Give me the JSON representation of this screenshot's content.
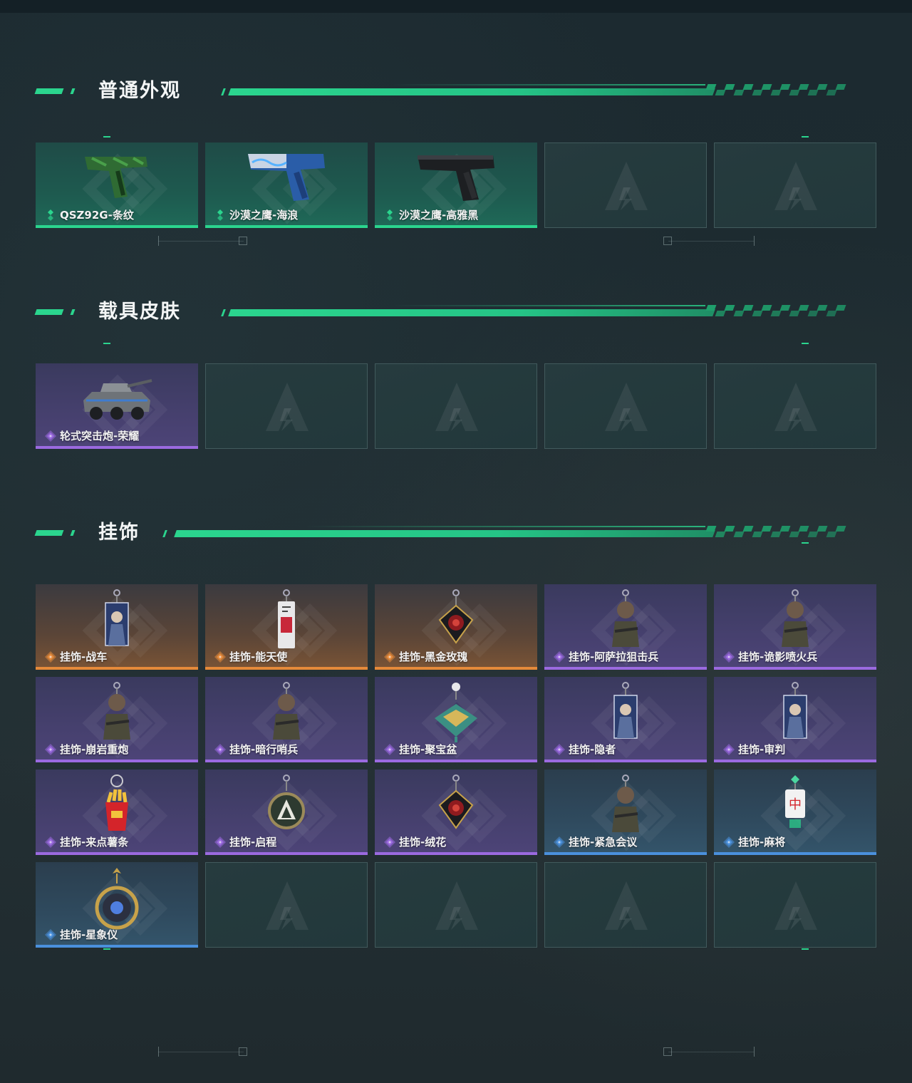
{
  "sections": [
    {
      "title": "普通外观",
      "items": [
        {
          "label": "QSZ92G-条纹",
          "rarity": "green",
          "icon": "pistol-camo-icon"
        },
        {
          "label": "沙漠之鹰-海浪",
          "rarity": "green",
          "icon": "pistol-wave-icon"
        },
        {
          "label": "沙漠之鹰-高雅黑",
          "rarity": "green",
          "icon": "pistol-black-icon"
        },
        {
          "label": "",
          "rarity": "empty"
        },
        {
          "label": "",
          "rarity": "empty"
        }
      ]
    },
    {
      "title": "载具皮肤",
      "items": [
        {
          "label": "轮式突击炮-荣耀",
          "rarity": "purple",
          "icon": "armored-vehicle-icon"
        },
        {
          "label": "",
          "rarity": "empty"
        },
        {
          "label": "",
          "rarity": "empty"
        },
        {
          "label": "",
          "rarity": "empty"
        },
        {
          "label": "",
          "rarity": "empty"
        }
      ]
    },
    {
      "title": "挂饰",
      "items": [
        {
          "label": "挂饰-战车",
          "rarity": "orange",
          "icon": "charm-card-icon"
        },
        {
          "label": "挂饰-能天使",
          "rarity": "orange",
          "icon": "charm-tag-icon"
        },
        {
          "label": "挂饰-黑金玫瑰",
          "rarity": "orange",
          "icon": "charm-rose-icon"
        },
        {
          "label": "挂饰-阿萨拉狙击兵",
          "rarity": "purple",
          "icon": "charm-figure-icon"
        },
        {
          "label": "挂饰-诡影喷火兵",
          "rarity": "purple",
          "icon": "charm-figure-icon"
        },
        {
          "label": "挂饰-崩岩重炮",
          "rarity": "purple",
          "icon": "charm-figure-icon"
        },
        {
          "label": "挂饰-暗行哨兵",
          "rarity": "purple",
          "icon": "charm-figure-icon"
        },
        {
          "label": "挂饰-聚宝盆",
          "rarity": "purple",
          "icon": "charm-treasure-icon"
        },
        {
          "label": "挂饰-隐者",
          "rarity": "purple",
          "icon": "charm-card-icon"
        },
        {
          "label": "挂饰-审判",
          "rarity": "purple",
          "icon": "charm-card-icon"
        },
        {
          "label": "挂饰-来点薯条",
          "rarity": "purple",
          "icon": "charm-fries-icon"
        },
        {
          "label": "挂饰-启程",
          "rarity": "purple",
          "icon": "charm-ring-icon"
        },
        {
          "label": "挂饰-绒花",
          "rarity": "purple",
          "icon": "charm-rose-icon"
        },
        {
          "label": "挂饰-紧急会议",
          "rarity": "blue",
          "icon": "charm-figure-icon"
        },
        {
          "label": "挂饰-麻将",
          "rarity": "blue",
          "icon": "charm-mahjong-icon"
        },
        {
          "label": "挂饰-星象仪",
          "rarity": "blue",
          "icon": "charm-astrolabe-icon"
        },
        {
          "label": "",
          "rarity": "empty"
        },
        {
          "label": "",
          "rarity": "empty"
        },
        {
          "label": "",
          "rarity": "empty"
        },
        {
          "label": "",
          "rarity": "empty"
        }
      ]
    }
  ],
  "colors": {
    "accent": "#2bd58e",
    "green": "#2bd58e",
    "purple": "#9b6ae0",
    "orange": "#e58a3a",
    "blue": "#4a90dc"
  }
}
